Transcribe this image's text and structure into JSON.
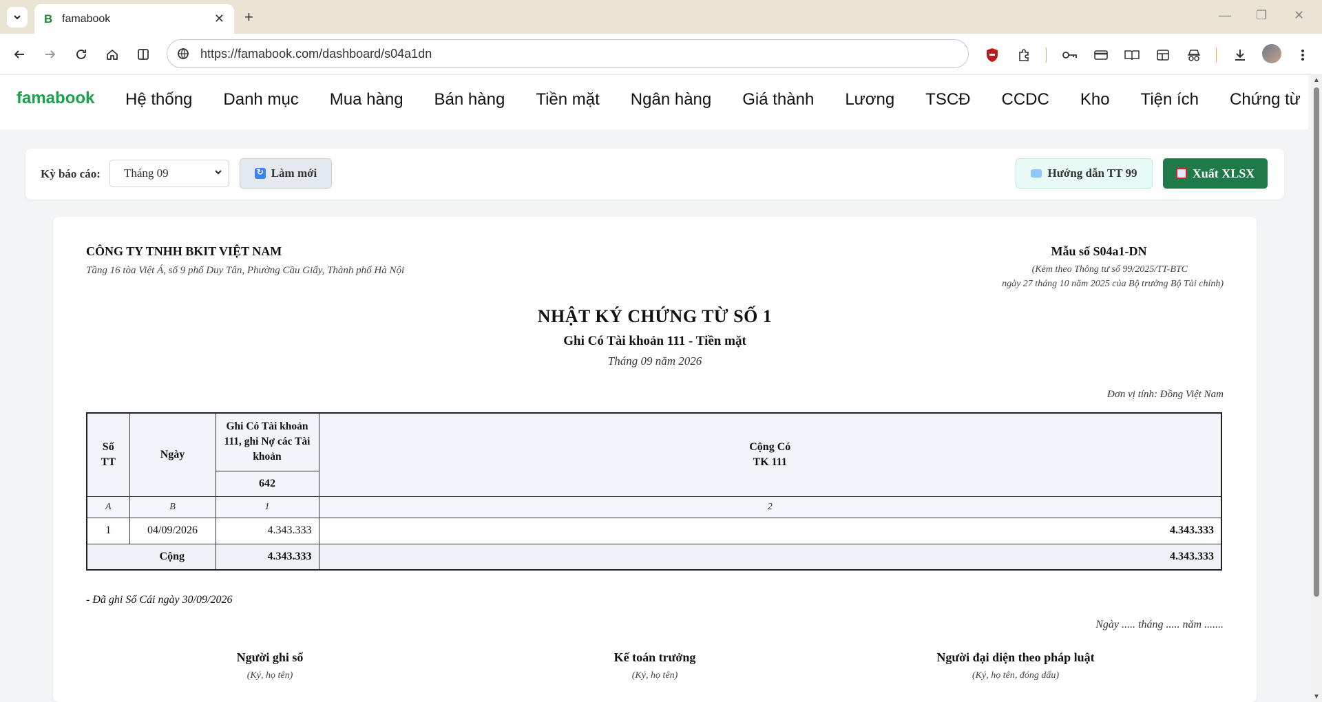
{
  "browser": {
    "tab_title": "famabook",
    "tab_favicon": "B",
    "url": "https://famabook.com/dashboard/s04a1dn"
  },
  "app": {
    "logo": "famabook",
    "menu": [
      "Hệ thống",
      "Danh mục",
      "Mua hàng",
      "Bán hàng",
      "Tiền mặt",
      "Ngân hàng",
      "Giá thành",
      "Lương",
      "TSCĐ",
      "CCDC",
      "Kho",
      "Tiện ích",
      "Chứng từ"
    ]
  },
  "filter": {
    "period_label": "Kỳ báo cáo:",
    "period_value": "Tháng 09",
    "refresh_label": "Làm mới",
    "guide_label": "Hướng dẫn TT 99",
    "export_label": "Xuất XLSX"
  },
  "report": {
    "company": "CÔNG TY TNHH BKIT VIỆT NAM",
    "address": "Tầng 16 tòa Việt Á, số 9 phố Duy Tân, Phường Cầu Giấy, Thành phố Hà Nội",
    "form_no": "Mẫu số S04a1-DN",
    "form_ref_1": "(Kèm theo Thông tư số 99/2025/TT-BTC",
    "form_ref_2": "ngày 27 tháng 10 năm 2025 của Bộ trưởng Bộ Tài chính)",
    "title": "NHẬT KÝ CHỨNG TỪ SỐ 1",
    "subtitle": "Ghi Có Tài khoản 111 - Tiền mặt",
    "period": "Tháng 09 năm 2026",
    "unit": "Đơn vị tính: Đồng Việt Nam",
    "table": {
      "h_stt": "Số TT",
      "h_date": "Ngày",
      "h_debit": "Ghi Có Tài khoản 111, ghi Nợ các Tài khoản",
      "h_total_1": "Cộng Có",
      "h_total_2": "TK 111",
      "h_account": "642",
      "idx_a": "A",
      "idx_b": "B",
      "idx_1": "1",
      "idx_2": "2",
      "rows": [
        {
          "stt": "1",
          "date": "04/09/2026",
          "acc642": "4.343.333",
          "total": "4.343.333"
        }
      ],
      "sum_label": "Cộng",
      "sum_642": "4.343.333",
      "sum_total": "4.343.333"
    },
    "note": "- Đã ghi Sổ Cái ngày 30/09/2026",
    "date_line": "Ngày ..... tháng ..... năm .......",
    "signers": [
      {
        "title": "Người ghi sổ",
        "sub": "(Ký, họ tên)"
      },
      {
        "title": "Kế toán trưởng",
        "sub": "(Ký, họ tên)"
      },
      {
        "title": "Người đại diện theo pháp luật",
        "sub": "(Ký, họ tên, đóng dấu)"
      }
    ]
  }
}
